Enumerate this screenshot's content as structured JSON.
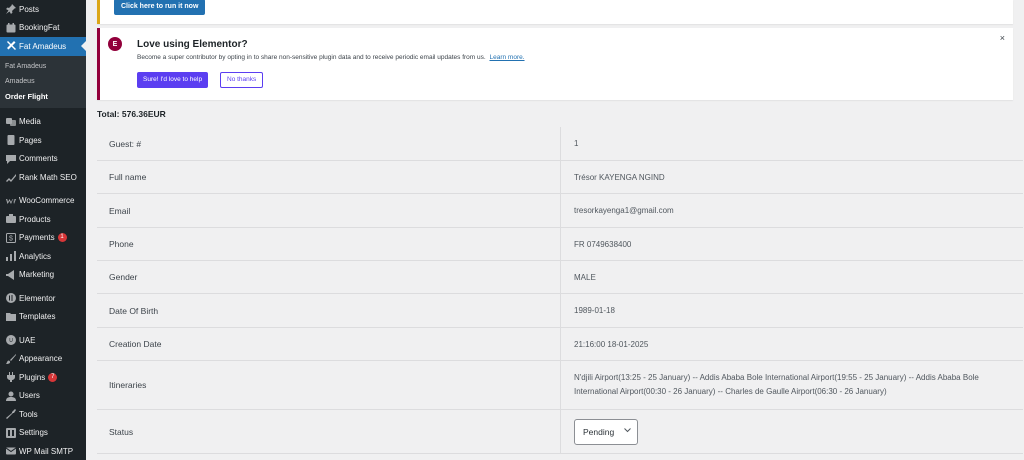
{
  "sidebar": {
    "items_top": [
      {
        "label": "Posts",
        "icon": "pin-icon"
      },
      {
        "label": "BookingFat",
        "icon": "calendar-icon"
      },
      {
        "label": "Fat Amadeus",
        "icon": "plane-icon",
        "active": true
      }
    ],
    "submenu": [
      {
        "label": "Fat Amadeus"
      },
      {
        "label": "Amadeus"
      },
      {
        "label": "Order Flight",
        "current": true
      }
    ],
    "items_bottom": [
      {
        "label": "Media",
        "icon": "media-icon"
      },
      {
        "label": "Pages",
        "icon": "pages-icon"
      },
      {
        "label": "Comments",
        "icon": "comments-icon"
      },
      {
        "label": "Rank Math SEO",
        "icon": "rankmath-icon"
      },
      {
        "label": "WooCommerce",
        "icon": "woocommerce-icon",
        "sep_before": true
      },
      {
        "label": "Products",
        "icon": "products-icon"
      },
      {
        "label": "Payments",
        "icon": "payments-icon",
        "badge": "1"
      },
      {
        "label": "Analytics",
        "icon": "analytics-icon"
      },
      {
        "label": "Marketing",
        "icon": "marketing-icon"
      },
      {
        "label": "Elementor",
        "icon": "elementor-icon",
        "sep_before": true
      },
      {
        "label": "Templates",
        "icon": "templates-icon"
      },
      {
        "label": "UAE",
        "icon": "uae-icon",
        "sep_before": true
      },
      {
        "label": "Appearance",
        "icon": "appearance-icon"
      },
      {
        "label": "Plugins",
        "icon": "plugins-icon",
        "badge": "7"
      },
      {
        "label": "Users",
        "icon": "users-icon"
      },
      {
        "label": "Tools",
        "icon": "tools-icon"
      },
      {
        "label": "Settings",
        "icon": "settings-icon"
      },
      {
        "label": "WP Mail SMTP",
        "icon": "mail-icon"
      }
    ]
  },
  "notice_top": {
    "button": "Click here to run it now"
  },
  "elementor_notice": {
    "logo": "E",
    "title": "Love using Elementor?",
    "description": "Become a super contributor by opting in to share non-sensitive plugin data and to receive periodic email updates from us.",
    "link": "Learn more.",
    "accept": "Sure! I'd love to help",
    "decline": "No thanks",
    "close": "×"
  },
  "total": "Total: 576.36EUR",
  "details": [
    {
      "label": "Guest: #",
      "value": "1"
    },
    {
      "label": "Full name",
      "value": "Trésor KAYENGA NGIND"
    },
    {
      "label": "Email",
      "value": "tresorkayenga1@gmail.com"
    },
    {
      "label": "Phone",
      "value": "FR 0749638400"
    },
    {
      "label": "Gender",
      "value": "MALE"
    },
    {
      "label": "Date Of Birth",
      "value": "1989-01-18"
    },
    {
      "label": "Creation Date",
      "value": "21:16:00 18-01-2025"
    },
    {
      "label": "Itineraries",
      "value": "N'djili Airport(13:25 - 25 January) -- Addis Ababa Bole International Airport(19:55 - 25 January) -- Addis Ababa Bole International Airport(00:30 - 26 January) -- Charles de Gaulle Airport(06:30 - 26 January)"
    },
    {
      "label": "Status",
      "value": "Pending",
      "type": "select"
    }
  ],
  "colors": {
    "accent": "#2271b1",
    "sidebar": "#1d2327",
    "elementor": "#92003b",
    "elementor_button": "#5b3ef1",
    "warning_border": "#dba617"
  }
}
